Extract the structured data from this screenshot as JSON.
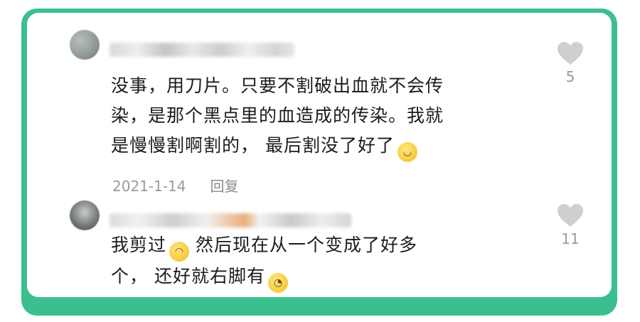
{
  "comments": [
    {
      "text_lines": [
        "没事，用刀片。只要不割破出血就不会传",
        "染，是那个黑点里的血造成的传染。我就",
        "是慢慢割啊割的，  最后割没了好了"
      ],
      "emoji_end": "😄",
      "date": "2021-1-14",
      "reply_label": "回复",
      "likes": "5",
      "icon": "heart-icon"
    },
    {
      "line1_a": "我剪过",
      "emoji_mid": "🤣",
      "line1_b": "然后现在从一个变成了好多",
      "line2": "个，  还好就右脚有",
      "emoji_end": "🥺",
      "likes": "11",
      "icon": "heart-icon"
    }
  ],
  "colors": {
    "frame": "#3bbf8f",
    "card": "#ffffff",
    "text": "#1b1b1b",
    "meta": "#9a9a9a",
    "like": "#cfcfcf"
  }
}
